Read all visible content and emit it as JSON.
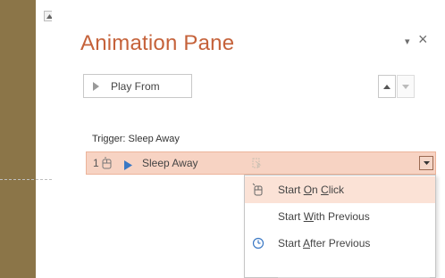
{
  "pane": {
    "title": "Animation Pane",
    "menu_glyph": "▾",
    "close_glyph": "×",
    "play_button_label": "Play From"
  },
  "trigger": {
    "label": "Trigger: Sleep Away"
  },
  "animation_row": {
    "order": "1",
    "name": "Sleep Away"
  },
  "menu": {
    "items": [
      {
        "prefix": "Start ",
        "key": "O",
        "middle": "n ",
        "key2": "C",
        "suffix": "lick",
        "icon": "mouse-click-icon"
      },
      {
        "prefix": "Start ",
        "key": "W",
        "suffix": "ith Previous",
        "icon": ""
      },
      {
        "prefix": "Start ",
        "key": "A",
        "suffix": "fter Previous",
        "icon": "clock-icon"
      }
    ]
  },
  "colors": {
    "accent": "#c5623a",
    "selection": "#f7d3c3",
    "menu_highlight": "#fbe2d6",
    "play_icon": "#3a78c4",
    "background": "#8b7548"
  }
}
